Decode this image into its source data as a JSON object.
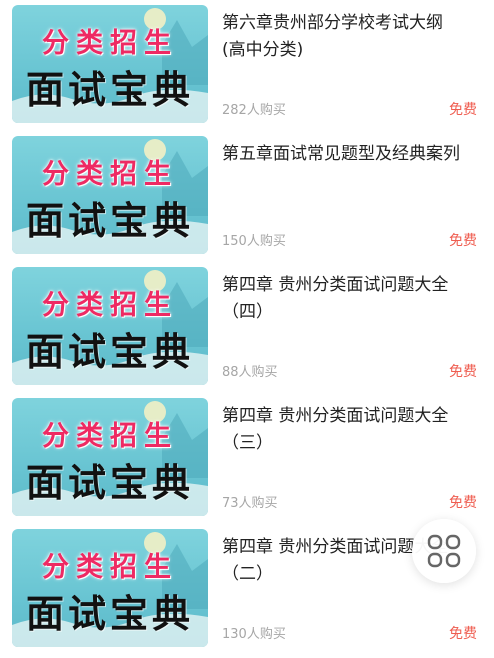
{
  "courses": [
    {
      "title": "第六章贵州部分学校考试大纲\n(高中分类)",
      "thumb_top": "分类招生",
      "thumb_bottom": "面试宝典",
      "buyers": "282人购买",
      "price": "免费"
    },
    {
      "title": "第五章面试常见题型及经典案列",
      "thumb_top": "分类招生",
      "thumb_bottom": "面试宝典",
      "buyers": "150人购买",
      "price": "免费"
    },
    {
      "title": "第四章 贵州分类面试问题大全\n（四）",
      "thumb_top": "分类招生",
      "thumb_bottom": "面试宝典",
      "buyers": "88人购买",
      "price": "免费"
    },
    {
      "title": "第四章 贵州分类面试问题大全\n（三）",
      "thumb_top": "分类招生",
      "thumb_bottom": "面试宝典",
      "buyers": "73人购买",
      "price": "免费"
    },
    {
      "title": "第四章 贵州分类面试问题大全\n（二）",
      "thumb_top": "分类招生",
      "thumb_bottom": "面试宝典",
      "buyers": "130人购买",
      "price": "免费"
    }
  ],
  "floating_button": {
    "icon": "grid-menu-icon"
  },
  "colors": {
    "price": "#ef5d50",
    "thumb_bg": "#6cc7d4",
    "thumb_pink": "#ee2a63"
  }
}
